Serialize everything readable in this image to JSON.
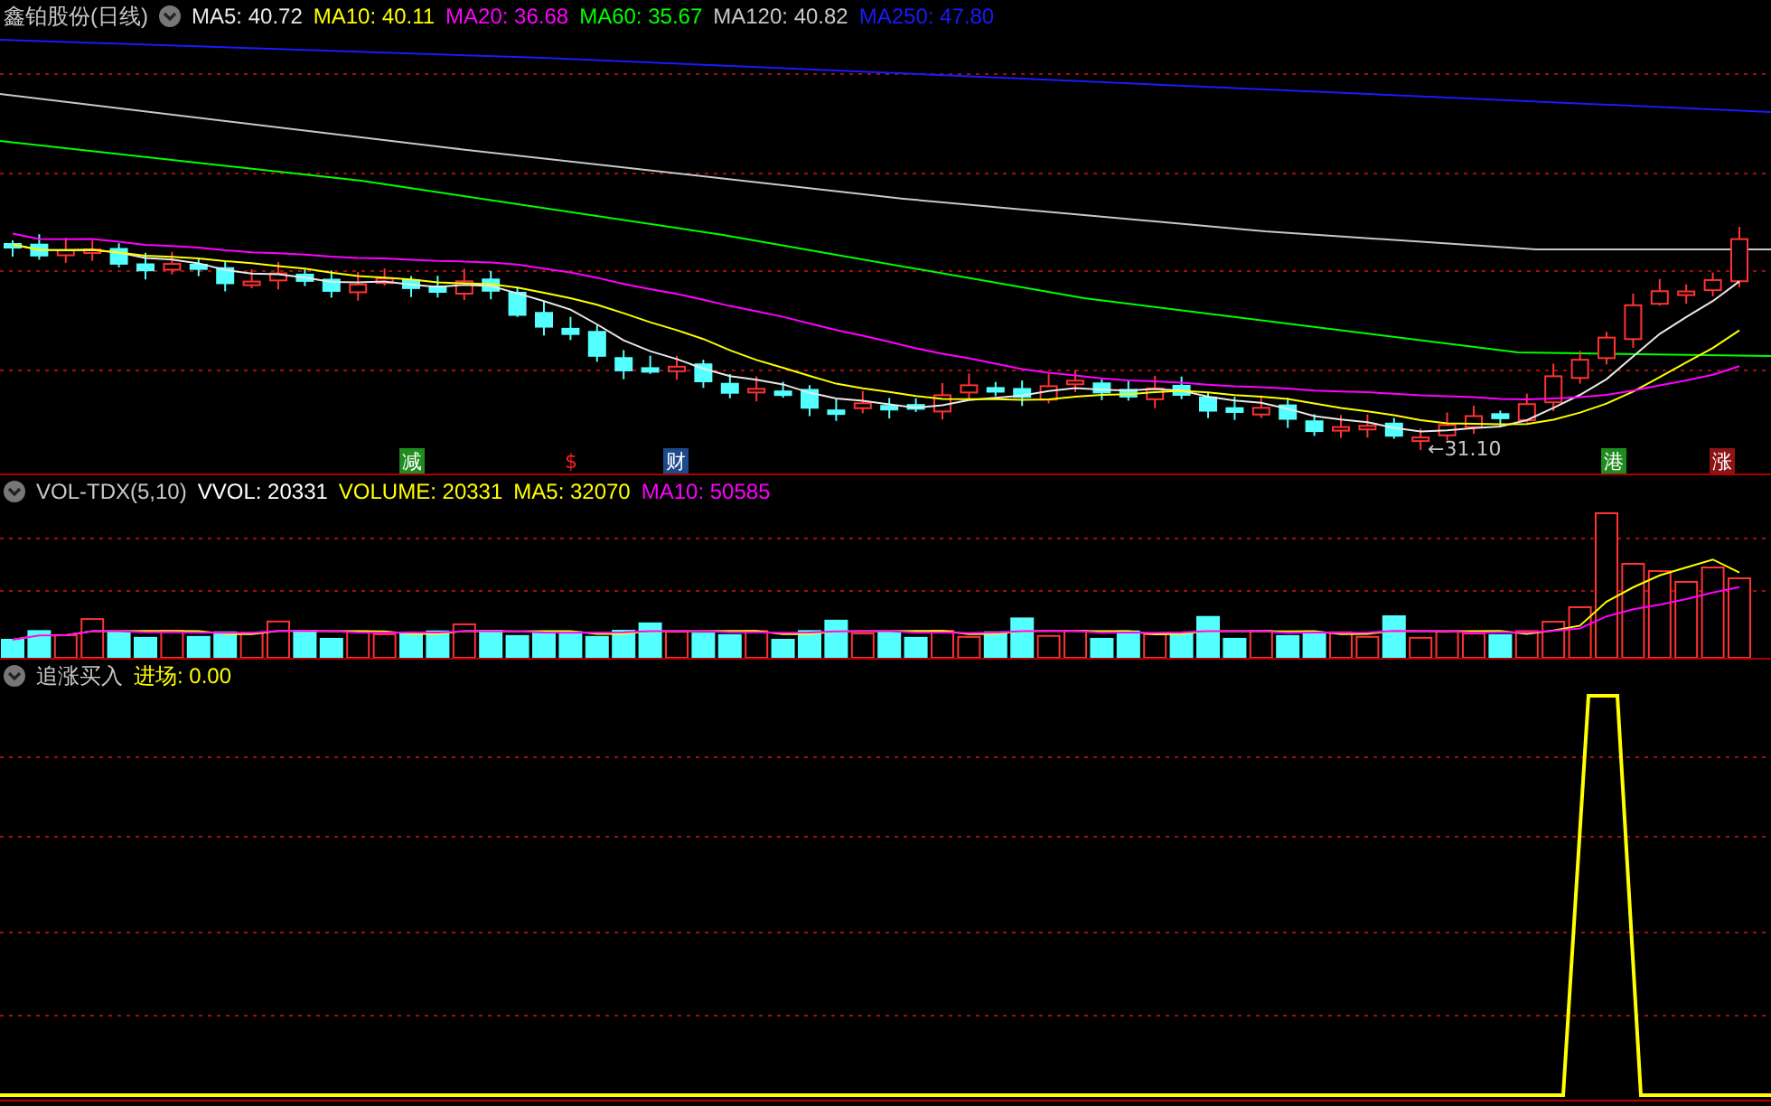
{
  "main_panel": {
    "title": "鑫铂股份(日线)",
    "indicators": [
      {
        "label": "MA5: 40.72",
        "color": "#e8e8e8"
      },
      {
        "label": "MA10: 40.11",
        "color": "#ffff00"
      },
      {
        "label": "MA20: 36.68",
        "color": "#ff00ff"
      },
      {
        "label": "MA60: 35.67",
        "color": "#00ff00"
      },
      {
        "label": "MA120: 40.82",
        "color": "#c8c8c8"
      },
      {
        "label": "MA250: 47.80",
        "color": "#1a1aff"
      }
    ],
    "markers": [
      {
        "text": "减",
        "kind": "box",
        "color": "#1e8c1e"
      },
      {
        "text": "$",
        "kind": "plain",
        "color": "#ff2020"
      },
      {
        "text": "财",
        "kind": "box",
        "color": "#1e4a8c"
      },
      {
        "text": "港",
        "kind": "box",
        "color": "#1e8c1e"
      },
      {
        "text": "涨",
        "kind": "box",
        "color": "#8c1414"
      }
    ],
    "low_label": "←31.10"
  },
  "volume_panel": {
    "title": "VOL-TDX(5,10)",
    "indicators": [
      {
        "label": "VVOL: 20331",
        "color": "#ffffff"
      },
      {
        "label": "VOLUME: 20331",
        "color": "#ffff00"
      },
      {
        "label": "MA5: 32070",
        "color": "#ffff00"
      },
      {
        "label": "MA10: 50585",
        "color": "#ff00ff"
      }
    ]
  },
  "signal_panel": {
    "title": "追涨买入",
    "indicators": [
      {
        "label": "进场: 0.00",
        "color": "#ffff00"
      }
    ]
  }
}
